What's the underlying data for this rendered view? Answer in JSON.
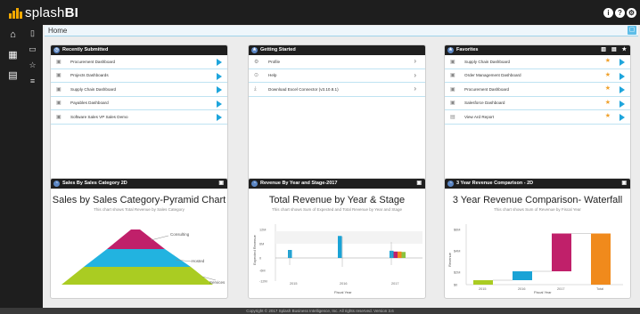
{
  "app": {
    "name_plain": "splash",
    "name_bold": "BI"
  },
  "top_icons": [
    "i",
    "?",
    "⚙"
  ],
  "breadcrumb": {
    "label": "Home"
  },
  "panels": {
    "recent": {
      "title": "Recently Submitted",
      "items": [
        {
          "label": "Procurement Dashboard"
        },
        {
          "label": "Projects Dashboards"
        },
        {
          "label": "Supply Chain Dashboard"
        },
        {
          "label": "Payables Dashboard"
        },
        {
          "label": "Software Sales VP Sales Demo"
        }
      ]
    },
    "getting_started": {
      "title": "Getting Started",
      "items": [
        {
          "label": "Profile"
        },
        {
          "label": "Help"
        },
        {
          "label": "Download Excel Connector (v3.10.8.1)"
        }
      ]
    },
    "favorites": {
      "title": "Favorites",
      "items": [
        {
          "label": "Supply Chain Dashboard"
        },
        {
          "label": "Order Management Dashboard"
        },
        {
          "label": "Procurement Dashboard"
        },
        {
          "label": "Salesforce Dashboard"
        },
        {
          "label": "View Ard Report"
        }
      ]
    },
    "pyramid": {
      "header": "Sales By Sales Category 2D",
      "title": "Sales by Sales Category-Pyramid Chart",
      "subtitle": "This chart shows Total Revenue by Sales Category"
    },
    "revenue_stage": {
      "header": "Revenue By Year and Stage-2017",
      "title": "Total Revenue by Year & Stage",
      "subtitle": "This chart shows Sum of Expected and Total Revenue by Year and Stage"
    },
    "waterfall": {
      "header": "3 Year Revenue Comparison - 2D",
      "title": "3 Year Revenue Comparison- Waterfall",
      "subtitle": "This chart shows Sum of Revenue by Fiscal Year"
    }
  },
  "chart_data": [
    {
      "type": "pyramid",
      "categories": [
        "Consulting",
        "Hosted",
        "Services"
      ],
      "colors": [
        "#c0206a",
        "#22b3e0",
        "#aacc22"
      ]
    },
    {
      "type": "bar",
      "categories": [
        "2015",
        "2016",
        "2017"
      ],
      "ylabel": "Expected Revenue",
      "xlabel": "Fiscal Year",
      "yticks": [
        "12M",
        "6M",
        "0",
        "-6M",
        "-12M"
      ],
      "series": [
        {
          "values": [
            2.0,
            5.5,
            1.8
          ],
          "color": "#1aa3d6"
        },
        {
          "values": [
            0,
            0,
            1.6
          ],
          "color": "#c0206a"
        },
        {
          "values": [
            0,
            0,
            1.6
          ],
          "color": "#f08a1c"
        },
        {
          "values": [
            0,
            0,
            1.5
          ],
          "color": "#8ac43f"
        }
      ]
    },
    {
      "type": "waterfall",
      "categories": [
        "2015",
        "2016",
        "2017",
        "Total"
      ],
      "xlabel": "Fiscal Year",
      "ylabel": "Revenue",
      "yticks": [
        "$6M",
        "$4M",
        "$2M",
        "$0"
      ],
      "steps": [
        {
          "start": 0,
          "end": 0.4,
          "color": "#aacc22"
        },
        {
          "start": 0.4,
          "end": 1.2,
          "color": "#1aa3d6"
        },
        {
          "start": 1.2,
          "end": 4.6,
          "color": "#c0206a"
        },
        {
          "start": 0,
          "end": 4.6,
          "color": "#f08a1c"
        }
      ]
    }
  ],
  "footer": {
    "text": "Copyright © 2017 Splash Business Intelligence, Inc. All rights reserved. Version 3.6"
  }
}
